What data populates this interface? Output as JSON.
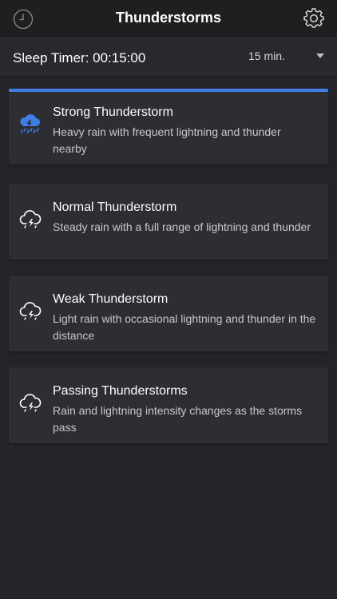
{
  "header": {
    "title": "Thunderstorms",
    "left_icon": "timer-clock-icon",
    "right_icon": "gear-icon"
  },
  "sleep_timer": {
    "label": "Sleep Timer: 00:15:00",
    "selected": "15 min."
  },
  "colors": {
    "accent": "#3d7fe6",
    "background": "#242428",
    "card": "#2d2d32"
  },
  "sounds": [
    {
      "title": "Strong Thunderstorm",
      "description": "Heavy rain with frequent lightning and thunder nearby",
      "icon": "storm-heavy-icon",
      "selected": true
    },
    {
      "title": "Normal Thunderstorm",
      "description": "Steady rain with a full range of lightning and thunder",
      "icon": "storm-cloud-icon",
      "selected": false
    },
    {
      "title": "Weak Thunderstorm",
      "description": "Light rain with occasional lightning and thunder in the distance",
      "icon": "storm-cloud-icon",
      "selected": false
    },
    {
      "title": "Passing Thunderstorms",
      "description": "Rain and lightning intensity changes as the storms pass",
      "icon": "storm-cloud-icon",
      "selected": false
    }
  ]
}
